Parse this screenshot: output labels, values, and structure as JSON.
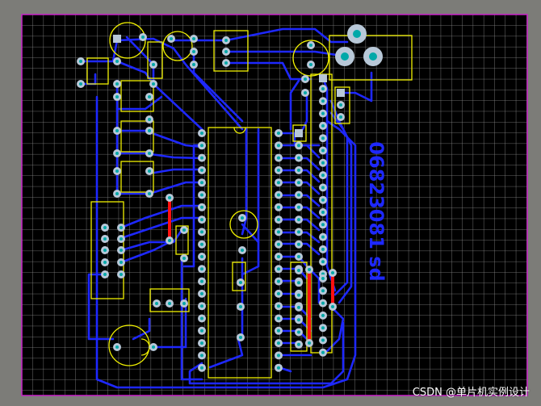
{
  "board_label": "06823081 sd",
  "watermark": "CSDN @单片机实例设计",
  "colors": {
    "background": "#7c7c78",
    "board": "#000000",
    "grid": "#8c8c8c",
    "outline": "#c820c8",
    "trace": "#1e28ff",
    "silk": "#f0f000",
    "pad": "#b8c8d8",
    "pad_hole": "#00a8a8",
    "jumper": "#ff1010"
  }
}
